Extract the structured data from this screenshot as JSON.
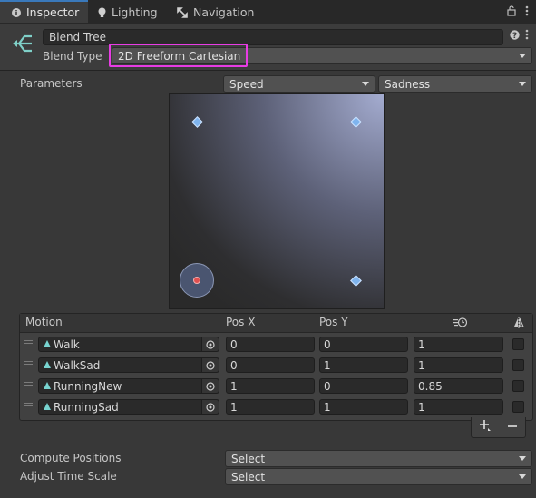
{
  "tabs": [
    {
      "label": "Inspector",
      "icon": "info-icon",
      "active": true
    },
    {
      "label": "Lighting",
      "icon": "lightbulb-icon",
      "active": false
    },
    {
      "label": "Navigation",
      "icon": "navigation-icon",
      "active": false
    }
  ],
  "header": {
    "name_value": "Blend Tree",
    "blend_type_label": "Blend Type",
    "blend_type_value": "2D Freeform Cartesian",
    "icon": "blend-tree-icon"
  },
  "parameters": {
    "label": "Parameters",
    "x_param": "Speed",
    "y_param": "Sadness"
  },
  "table": {
    "headers": {
      "motion": "Motion",
      "posx": "Pos X",
      "posy": "Pos Y"
    },
    "rows": [
      {
        "motion": "Walk",
        "posx": "0",
        "posy": "0",
        "speed": "1"
      },
      {
        "motion": "WalkSad",
        "posx": "0",
        "posy": "1",
        "speed": "1"
      },
      {
        "motion": "RunningNew",
        "posx": "1",
        "posy": "0",
        "speed": "0.85"
      },
      {
        "motion": "RunningSad",
        "posx": "1",
        "posy": "1",
        "speed": "1"
      }
    ]
  },
  "footer": {
    "compute_label": "Compute Positions",
    "compute_value": "Select",
    "adjust_label": "Adjust Time Scale",
    "adjust_value": "Select"
  },
  "colors": {
    "accent_highlight": "#e83ce4",
    "active_tab_line": "#3a79bb",
    "point_color": "#7fb4ee",
    "current_point": "#e05050"
  }
}
